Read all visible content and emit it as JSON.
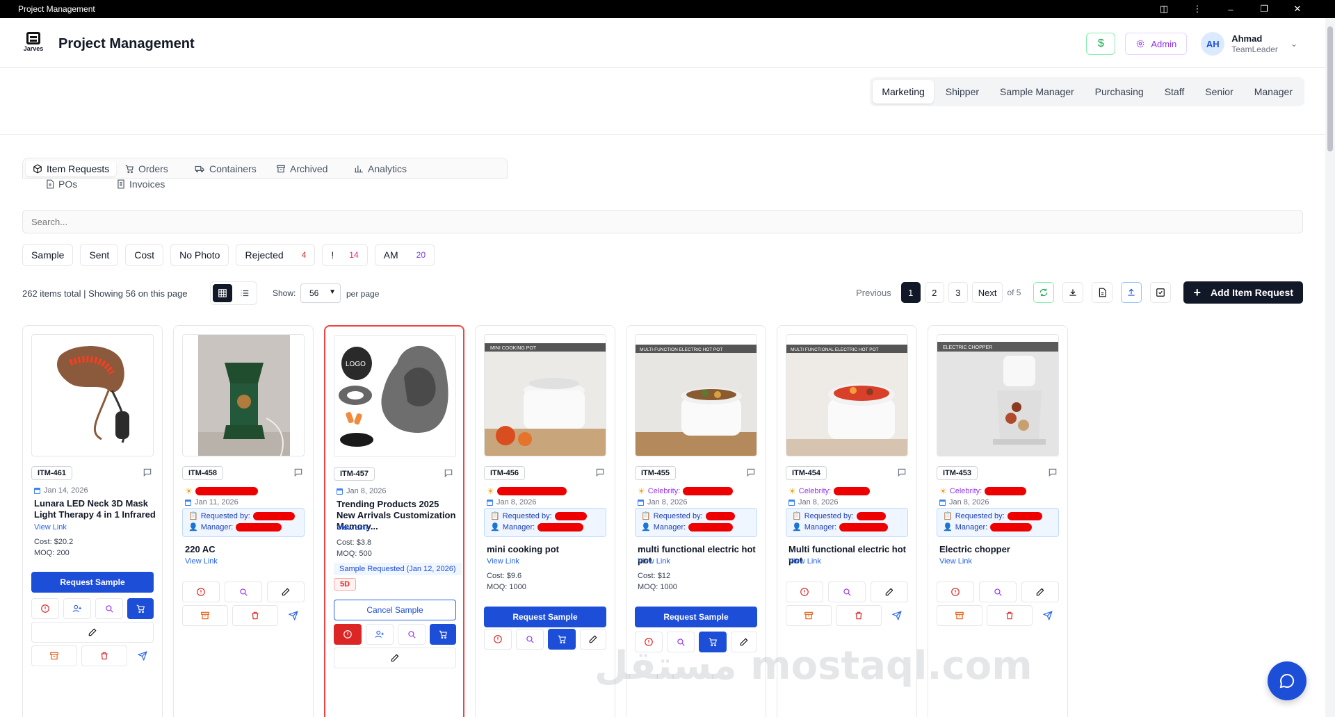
{
  "window": {
    "title": "Project Management"
  },
  "header": {
    "logo_text": "Jarves",
    "title": "Project Management",
    "dollar_icon": "$",
    "admin_label": "Admin",
    "user": {
      "initials": "AH",
      "name": "Ahmad",
      "role": "TeamLeader"
    }
  },
  "roles": [
    "Marketing",
    "Shipper",
    "Sample Manager",
    "Purchasing",
    "Staff",
    "Senior",
    "Manager"
  ],
  "active_role": "Marketing",
  "tabs": {
    "row1": [
      "Item Requests",
      "Orders",
      "Containers",
      "Archived",
      "Analytics"
    ],
    "row2": [
      "POs",
      "Invoices"
    ],
    "active": "Item Requests"
  },
  "search": {
    "placeholder": "Search..."
  },
  "filters": [
    {
      "label": "Sample",
      "count": ""
    },
    {
      "label": "Sent",
      "count": ""
    },
    {
      "label": "Cost",
      "count": ""
    },
    {
      "label": "No Photo",
      "count": ""
    },
    {
      "label": "Rejected",
      "count": "4"
    },
    {
      "label": "!",
      "count": "14"
    },
    {
      "label": "AM",
      "count": "20"
    }
  ],
  "status": {
    "totals": "262 items total | Showing 56 on this page",
    "show_label": "Show:",
    "per_page_value": "56",
    "per_page_label": "per page"
  },
  "pagination": {
    "previous": "Previous",
    "pages": [
      "1",
      "2",
      "3"
    ],
    "current": "1",
    "next": "Next",
    "of_text": "of 5"
  },
  "add_button": "Add Item Request",
  "colors": {
    "primary": "#1d4ed8",
    "danger": "#dc2626",
    "dark": "#111827",
    "highlight_border": "#ef4444"
  },
  "cards": [
    {
      "id": "ITM-461",
      "date": "Jan 14, 2026",
      "title": "Lunara LED Neck 3D Mask Light Therapy 4 in 1 Infrared",
      "view_link": "View Link",
      "cost": "Cost: $20.2",
      "moq": "MOQ: 200",
      "primary_action": "Request Sample"
    },
    {
      "id": "ITM-458",
      "date": "Jan 11, 2026",
      "requested_by_label": "Requested by:",
      "manager_label": "Manager:",
      "title": "220 AC",
      "view_link": "View Link"
    },
    {
      "id": "ITM-457",
      "date": "Jan 8, 2026",
      "title": "Trending Products 2025 New Arrivals Customization Memory...",
      "view_link": "View Link",
      "cost": "Cost: $3.8",
      "moq": "MOQ: 500",
      "sample_status": "Sample Requested (Jan 12, 2026)",
      "days_tag": "5D",
      "image_text": "LOGO",
      "secondary_action": "Cancel Sample"
    },
    {
      "id": "ITM-456",
      "date": "Jan 8, 2026",
      "requested_by_label": "Requested by:",
      "manager_label": "Manager:",
      "image_banner": "MINI COOKING POT",
      "title": "mini cooking pot",
      "view_link": "View Link",
      "cost": "Cost: $9.6",
      "moq": "MOQ: 1000",
      "primary_action": "Request Sample"
    },
    {
      "id": "ITM-455",
      "date": "Jan 8, 2026",
      "celebrity_label": "Celebrity:",
      "requested_by_label": "Requested by:",
      "manager_label": "Manager:",
      "image_banner": "MULTI-FUNCTION ELECTRIC HOT POT",
      "title": "multi functional electric hot pot",
      "view_link": "View Link",
      "cost": "Cost: $12",
      "moq": "MOQ: 1000",
      "primary_action": "Request Sample"
    },
    {
      "id": "ITM-454",
      "date": "Jan 8, 2026",
      "celebrity_label": "Celebrity:",
      "requested_by_label": "Requested by:",
      "manager_label": "Manager:",
      "image_banner": "MULTI FUNCTIONAL ELECTRIC HOT POT",
      "title": "Multi functional electric hot pot",
      "view_link": "View Link"
    },
    {
      "id": "ITM-453",
      "date": "Jan 8, 2026",
      "celebrity_label": "Celebrity:",
      "requested_by_label": "Requested by:",
      "manager_label": "Manager:",
      "image_banner": "ELECTRIC CHOPPER",
      "title": "Electric chopper",
      "view_link": "View Link"
    }
  ],
  "watermark_text": "مستقل mostaql.com"
}
